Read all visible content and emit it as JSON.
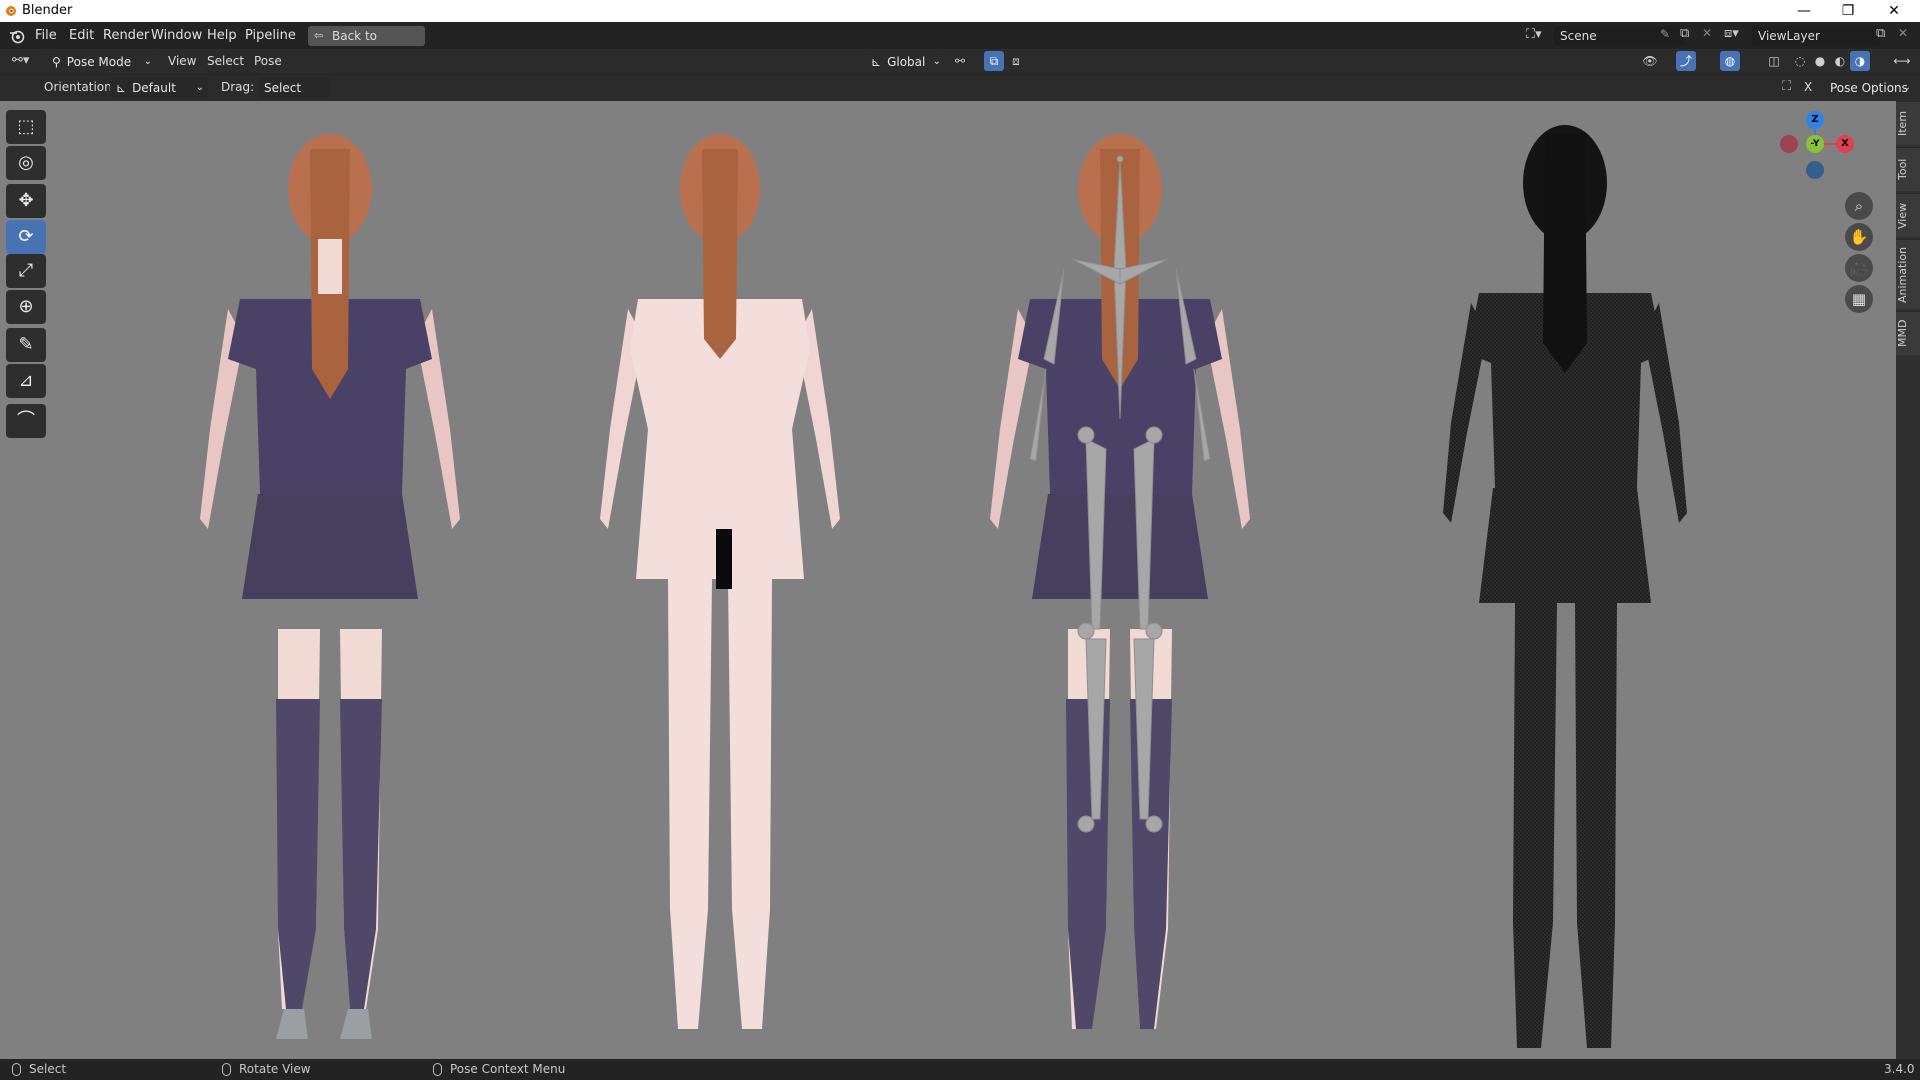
{
  "window": {
    "title": "Blender",
    "controls": [
      "—",
      "❐",
      "✕"
    ]
  },
  "menubar": {
    "items": [
      "File",
      "Edit",
      "Render",
      "Window",
      "Help",
      "Pipeline"
    ],
    "back_button": "Back to Previous",
    "scene_label": "Scene",
    "viewlayer_label": "ViewLayer"
  },
  "header": {
    "mode": "Pose Mode",
    "menus": [
      "View",
      "Select",
      "Pose"
    ],
    "transform_orientation": "Global"
  },
  "tool_settings": {
    "orientation_label": "Orientation:",
    "orientation_value": "Default",
    "drag_label": "Drag:",
    "drag_value": "Select Box",
    "pose_options": "Pose Options"
  },
  "toolbar": {
    "tools": [
      {
        "name": "select-box-icon",
        "glyph": "⬚",
        "active": false
      },
      {
        "name": "cursor-icon",
        "glyph": "◎",
        "active": false
      },
      {
        "name": "move-icon",
        "glyph": "✥",
        "active": false
      },
      {
        "name": "rotate-icon",
        "glyph": "⟳",
        "active": true
      },
      {
        "name": "scale-icon",
        "glyph": "⤢",
        "active": false
      },
      {
        "name": "transform-icon",
        "glyph": "⊕",
        "active": false
      },
      {
        "name": "annotate-icon",
        "glyph": "✎",
        "active": false
      },
      {
        "name": "measure-icon",
        "glyph": "📐",
        "active": false
      },
      {
        "name": "relax-pose-icon",
        "glyph": "⌒",
        "active": false
      }
    ]
  },
  "gizmo": {
    "z": "Z",
    "y": "-Y",
    "x": "X",
    "colors": {
      "x": "#e0404f",
      "y": "#8ac33a",
      "z": "#2f84e3"
    }
  },
  "sidebar_tabs": [
    "Item",
    "Tool",
    "View",
    "Animation",
    "MMD"
  ],
  "statusbar": {
    "left": "Select",
    "middle": "Rotate View",
    "right": "Pose Context Menu",
    "version": "3.4.0"
  },
  "colors": {
    "accent": "#4772b3",
    "viewport_bg": "#808080",
    "skin": "#f1d9d4",
    "hair": "#b8704f",
    "shirt": "#4a4266",
    "stocking": "#4f4868",
    "bone": "#a7a7a7"
  }
}
